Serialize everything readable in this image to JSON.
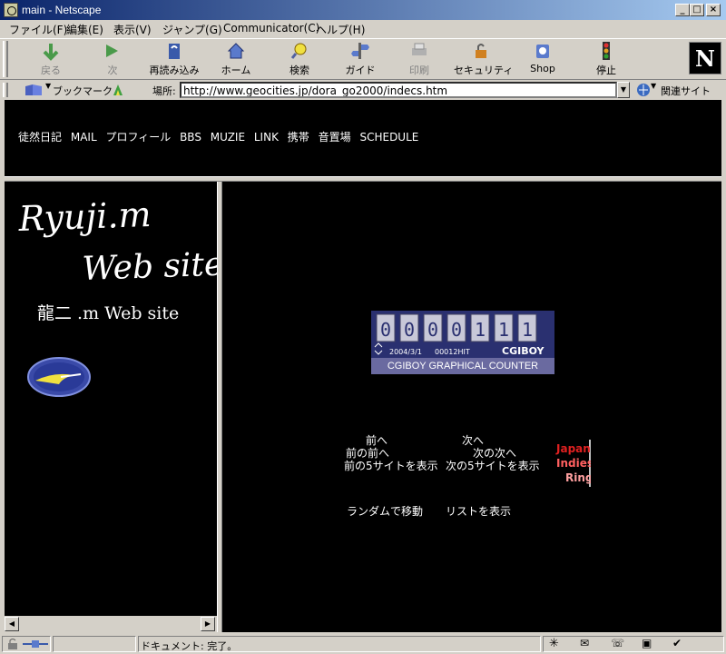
{
  "window": {
    "title": "main - Netscape"
  },
  "menu": [
    "ファイル(F)",
    "編集(E)",
    "表示(V)",
    "ジャンプ(G)",
    "Communicator(C)",
    "ヘルプ(H)"
  ],
  "toolbar": {
    "back": "戻る",
    "forward": "次",
    "reload": "再読み込み",
    "home": "ホーム",
    "search": "検索",
    "guide": "ガイド",
    "print": "印刷",
    "security": "セキュリティ",
    "shop": "Shop",
    "stop": "停止"
  },
  "location": {
    "bookmarks": "ブックマーク",
    "label": "場所:",
    "url": "http://www.geocities.jp/dora_go2000/indecs.htm",
    "related": "関連サイト"
  },
  "nav": {
    "logo": "N",
    "links": [
      "徒然日記",
      "MAIL",
      "プロフィール",
      "BBS",
      "MUZIE",
      "LINK",
      "携帯",
      "音置場",
      "SCHEDULE"
    ]
  },
  "left": {
    "logo_line1": "Ryuji.m",
    "logo_line2": "Web site",
    "subtitle": "龍二 .m Web site"
  },
  "counter": {
    "digits": "0000111",
    "date": "2004/3/1",
    "hits": "00012HIT",
    "brand": "CGIBOY",
    "caption": "CGIBOY GRAPHICAL COUNTER"
  },
  "ring": {
    "prev": "前へ",
    "next": "次へ",
    "prev_prev": "前の前へ",
    "next_next": "次の次へ",
    "prev5": "前の5サイトを表示",
    "next5": "次の5サイトを表示",
    "random": "ランダムで移動",
    "list": "リストを表示",
    "logo": [
      "Japan",
      "Indies",
      "Ring"
    ]
  },
  "status": {
    "text": "ドキュメント: 完了。"
  }
}
